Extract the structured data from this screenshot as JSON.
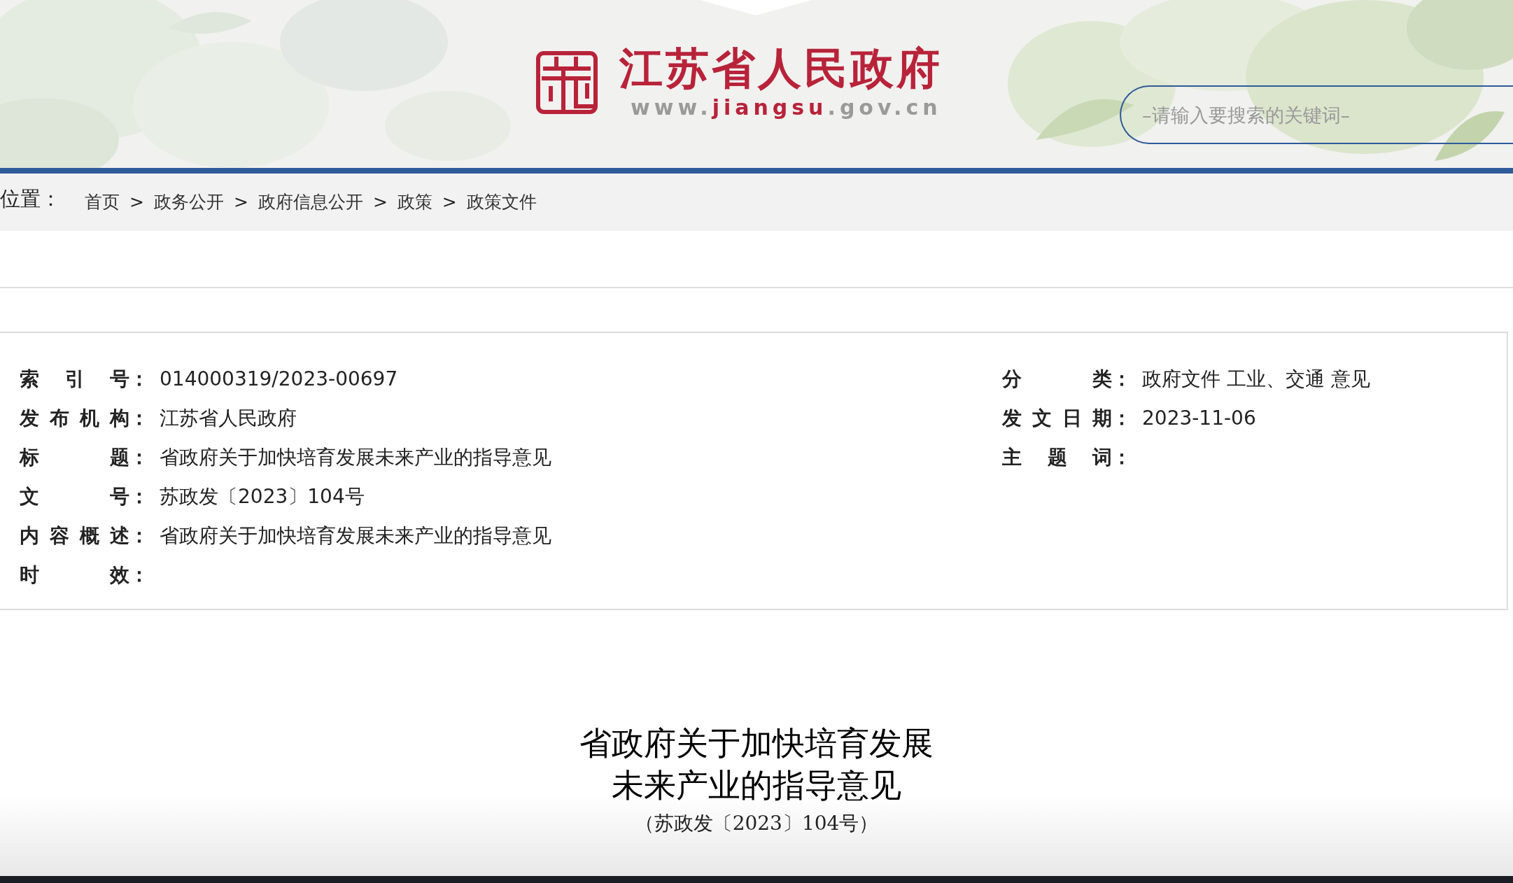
{
  "header": {
    "site_title": "江苏省人民政府",
    "site_url": [
      {
        "text": "www.",
        "color": "#9a9a9a"
      },
      {
        "text": "jiangsu",
        "color": "#b8233a"
      },
      {
        "text": ".gov.cn",
        "color": "#9a9a9a"
      }
    ],
    "search": {
      "placeholder": "–请输入要搜索的关键词–"
    }
  },
  "breadcrumb": {
    "label": "位置：",
    "items": [
      {
        "kind": "link",
        "text": "首页"
      },
      {
        "kind": "separator",
        "text": ">"
      },
      {
        "kind": "link",
        "text": "政务公开"
      },
      {
        "kind": "separator",
        "text": ">"
      },
      {
        "kind": "link",
        "text": "政府信息公开"
      },
      {
        "kind": "separator",
        "text": ">"
      },
      {
        "kind": "link",
        "text": "政策"
      },
      {
        "kind": "separator",
        "text": ">"
      },
      {
        "kind": "link",
        "text": "政策文件"
      }
    ]
  },
  "info": {
    "left": [
      {
        "label": "索引号",
        "colon": "：",
        "value": "014000319/2023-00697"
      },
      {
        "label": "发布机构",
        "colon": "：",
        "value": "江苏省人民政府"
      },
      {
        "label": "标题",
        "colon": "：",
        "value": "省政府关于加快培育发展未来产业的指导意见"
      },
      {
        "label": "文号",
        "colon": "：",
        "value": "苏政发〔2023〕104号"
      },
      {
        "label": "内容概述",
        "colon": "：",
        "value": "省政府关于加快培育发展未来产业的指导意见"
      },
      {
        "label": "时效",
        "colon": "："
      }
    ],
    "right": [
      {
        "label": "分类",
        "colon": "：",
        "value": "政府文件 工业、交通 意见"
      },
      {
        "label": "发文日期",
        "colon": "：",
        "value": "2023-11-06"
      },
      {
        "label": "主题词",
        "colon": "："
      }
    ]
  },
  "document": {
    "title_lines": [
      "省政府关于加快培育发展",
      "未来产业的指导意见"
    ],
    "doc_number": "（苏政发〔2023〕104号）"
  }
}
